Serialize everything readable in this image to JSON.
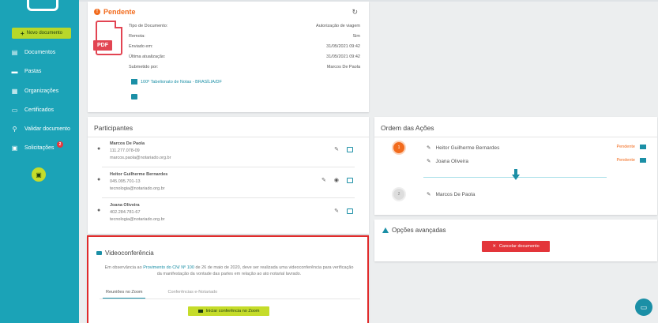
{
  "sidebar": {
    "new_document": "Novo documento",
    "items": [
      {
        "label": "Documentos",
        "icon": "document-icon"
      },
      {
        "label": "Pastas",
        "icon": "folder-icon"
      },
      {
        "label": "Organizações",
        "icon": "building-icon"
      },
      {
        "label": "Certificados",
        "icon": "certificate-icon"
      },
      {
        "label": "Validar documento",
        "icon": "search-icon"
      },
      {
        "label": "Solicitações",
        "icon": "request-icon",
        "badge": "2"
      }
    ]
  },
  "status": {
    "title": "Pendente",
    "file_type": "PDF",
    "rows": [
      {
        "label": "Tipo de Documento:",
        "value": "Autorização de viagem"
      },
      {
        "label": "Remota:",
        "value": "Sim"
      },
      {
        "label": "Enviado em:",
        "value": "31/05/2021 09:42"
      },
      {
        "label": "Última atualização:",
        "value": "31/05/2021 09:42"
      },
      {
        "label": "Submetido por:",
        "value": "Marcos De Paola"
      }
    ],
    "office": "100º Tabelionato de Notas - BRASÍLIA/DF"
  },
  "participants": {
    "title": "Participantes",
    "list": [
      {
        "name": "Marcos De Paola",
        "doc": "111.277.078-09",
        "email": "marcos.paola@notariado.org.br"
      },
      {
        "name": "Heitor Guilherme Bernardes",
        "doc": "045.095.701-13",
        "email": "tecnologia@notariado.org.br"
      },
      {
        "name": "Joana Oliveira",
        "doc": "402.284.781-67",
        "email": "tecnologia@notariado.org.br"
      }
    ]
  },
  "video": {
    "title": "Videoconferência",
    "text_before": "Em observância ao",
    "link": "Provimento do CN/ Nº 100",
    "text_after": "de 26 de maio de 2020, deve ser realizada uma videoconferência para verificação da manifestação da vontade das partes em relação ao ato notarial lavrado.",
    "tabs": [
      "Reuniões no Zoom",
      "Conferências e-Notariado"
    ],
    "button": "Iniciar conferência no Zoom"
  },
  "order": {
    "title": "Ordem das Ações",
    "steps": [
      {
        "num": "1",
        "names": [
          "Heitor Guilherme Bernardes",
          "Joana Oliveira"
        ],
        "status": "Pendente"
      },
      {
        "num": "2",
        "names": [
          "Marcos De Paola"
        ]
      }
    ]
  },
  "advanced": {
    "title": "Opções avançadas",
    "cancel": "Cancelar documento"
  },
  "colors": {
    "brand": "#1ba3b7",
    "accent_green": "#c5dc2a",
    "pending": "#f26b1d",
    "danger": "#e3353a"
  }
}
